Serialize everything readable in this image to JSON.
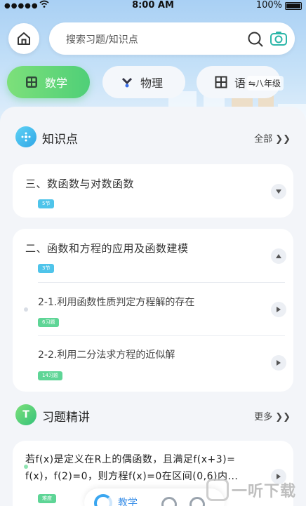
{
  "status": {
    "signal": "●●●●●",
    "time": "8:00 AM",
    "battery": "100%"
  },
  "search": {
    "placeholder": "搜索习题/知识点"
  },
  "tabs": [
    {
      "label": "数学",
      "active": true
    },
    {
      "label": "物理",
      "active": false
    },
    {
      "label": "语",
      "active": false
    }
  ],
  "grade": "⇋八年级",
  "knowledge": {
    "title": "知识点",
    "more": "全部 ❯❯",
    "chapters": [
      {
        "title": "三、数函数与对数函数",
        "tag": "5节",
        "expanded": false
      },
      {
        "title": "二、函数和方程的应用及函数建模",
        "tag": "3节",
        "expanded": true,
        "items": [
          {
            "title": "2-1.利用函数性质判定方程解的存在",
            "tag": "6习题"
          },
          {
            "title": "2-2.利用二分法求方程的近似解",
            "tag": "14习题"
          }
        ]
      }
    ]
  },
  "exercise": {
    "title": "习题精讲",
    "more": "更多 ❯❯",
    "question": {
      "line1": "若f(x)是定义在R上的偶函数，且满足f(x+3)=",
      "line2": "f(x)，f(2)=0，则方程f(x)=0在区间(0,6)内...",
      "tag": "难度"
    }
  },
  "bottom_nav": {
    "label": "教学"
  },
  "watermark": "一听下载",
  "colors": {
    "accent_green": "#4fcf78",
    "accent_blue": "#4fc4ea",
    "hero": "#a9d0f4"
  }
}
